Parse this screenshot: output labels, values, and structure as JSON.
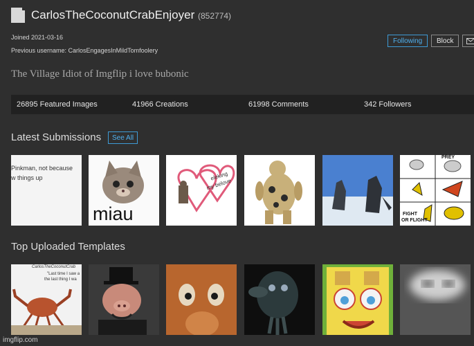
{
  "profile": {
    "username": "CarlosTheCoconutCrabEnjoyer",
    "user_id": "(852774)",
    "joined": "Joined 2021-03-16",
    "previous_username": "Previous username: CarlosEngagesInMildTomfoolery",
    "bio": "The Village Idiot of Imgflip i love bubonic"
  },
  "actions": {
    "following": "Following",
    "block": "Block"
  },
  "stats": {
    "featured": "26895 Featured Images",
    "creations": "41966 Creations",
    "comments": "61998 Comments",
    "followers": "342 Followers"
  },
  "latest": {
    "title": "Latest Submissions",
    "see_all": "See All",
    "items": [
      {
        "text_1": "Pinkman, not because",
        "text_2": "w things up"
      },
      {
        "text": "miau"
      },
      {
        "text_1": "eleking",
        "text_2": "my belove"
      },
      {},
      {},
      {
        "prey": "PREY",
        "fight_1": "FIGHT",
        "fight_2": "OR FLIGHT"
      }
    ]
  },
  "templates": {
    "title": "Top Uploaded Templates",
    "items": [
      {
        "text_1": "CarlosTheCoconutCrab",
        "text_2": "\"Last time I saw a",
        "text_3": "the last thing I wa"
      },
      {},
      {},
      {},
      {},
      {}
    ]
  },
  "footer": {
    "watermark": "imgflip.com"
  },
  "icons": {
    "avatar": "avatar-icon",
    "message": "envelope-icon"
  }
}
